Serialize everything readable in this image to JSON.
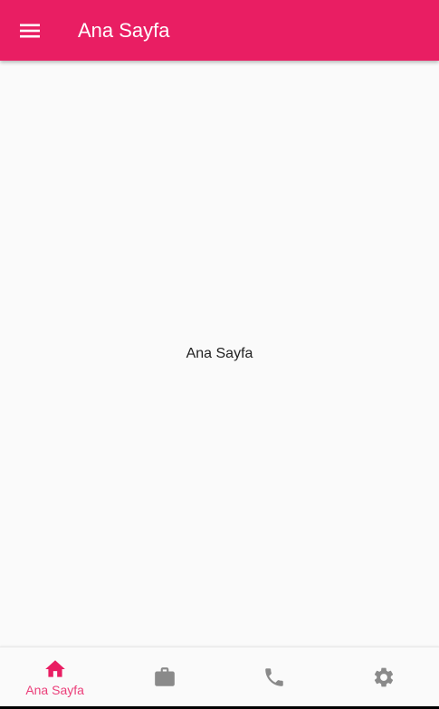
{
  "app_bar": {
    "title": "Ana Sayfa",
    "menu_icon": "hamburger-menu-icon",
    "background": "#e91e63"
  },
  "body": {
    "text": "Ana Sayfa"
  },
  "bottom_nav": {
    "active_color": "#e91e63",
    "inactive_color": "#8a8a8a",
    "items": [
      {
        "icon": "home-icon",
        "label": "Ana Sayfa",
        "active": true
      },
      {
        "icon": "briefcase-icon",
        "label": "",
        "active": false
      },
      {
        "icon": "phone-icon",
        "label": "",
        "active": false
      },
      {
        "icon": "settings-gear-icon",
        "label": "",
        "active": false
      }
    ]
  }
}
